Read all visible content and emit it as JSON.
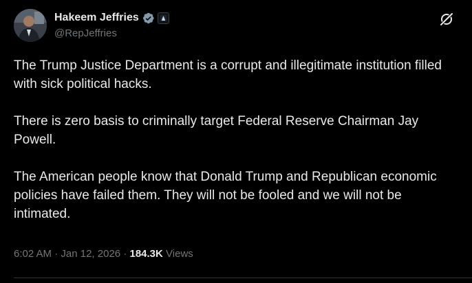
{
  "author": {
    "display_name": "Hakeem Jeffries",
    "handle": "@RepJeffries",
    "avatar_icon": "profile-photo",
    "verified_icon": "verified-badge-icon",
    "affiliation_icon": "government-affiliation-icon"
  },
  "actions": {
    "grok_icon": "grok-icon"
  },
  "tweet": {
    "paragraphs": [
      "The Trump Justice Department is a corrupt and illegitimate institution filled with sick political hacks.",
      "There is zero basis to criminally target Federal Reserve Chairman Jay Powell.",
      "The American people know that Donald Trump and Republican economic policies have failed them. They will not be fooled and we will not be intimated."
    ]
  },
  "meta": {
    "time": "6:02 AM",
    "separator": "·",
    "date": "Jan 12, 2026",
    "views_count": "184.3K",
    "views_label": "Views"
  },
  "colors": {
    "background": "#000000",
    "text_primary": "#e7e9ea",
    "text_secondary": "#71767b",
    "verified_badge": "#829aab",
    "divider": "#2f3336"
  }
}
